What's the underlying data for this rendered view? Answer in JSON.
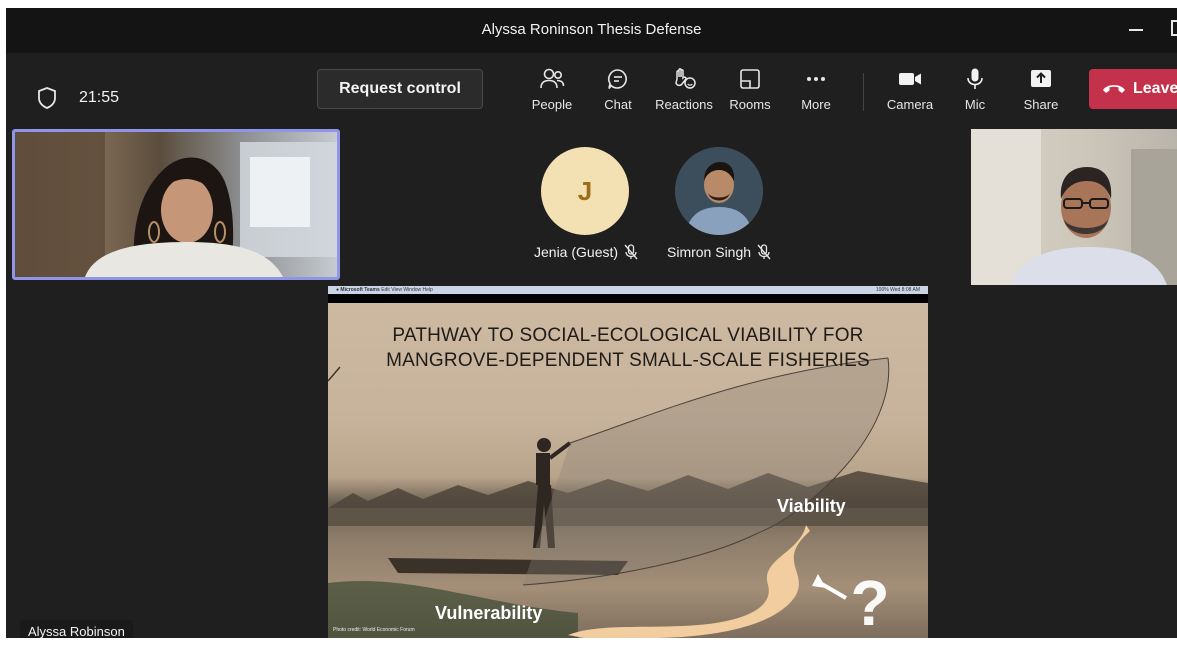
{
  "window": {
    "title": "Alyssa Roninson Thesis Defense"
  },
  "toolbar": {
    "timer": "21:55",
    "request_control": "Request control",
    "items": [
      {
        "label": "People",
        "icon": "people-icon"
      },
      {
        "label": "Chat",
        "icon": "chat-icon"
      },
      {
        "label": "Reactions",
        "icon": "reactions-icon"
      },
      {
        "label": "Rooms",
        "icon": "rooms-icon"
      },
      {
        "label": "More",
        "icon": "more-icon"
      },
      {
        "label": "Camera",
        "icon": "camera-icon"
      },
      {
        "label": "Mic",
        "icon": "mic-icon"
      },
      {
        "label": "Share",
        "icon": "share-icon"
      }
    ],
    "leave": "Leave",
    "leave_color": "#c4314b"
  },
  "participants": [
    {
      "name": "Alyssa Robinson",
      "active_speaker": true
    },
    {
      "name": "Jenia (Guest)",
      "initial": "J",
      "muted": true
    },
    {
      "name": "Simron Singh",
      "muted": true
    }
  ],
  "accent": "#8f95e8",
  "shared_screen": {
    "menu_bar": {
      "app": "Microsoft Teams",
      "menus": [
        "Edit",
        "View",
        "Window",
        "Help"
      ],
      "status": "100% Wed 8:08 AM"
    },
    "slide": {
      "title_line1": "PATHWAY TO SOCIAL-ECOLOGICAL VIABILITY FOR",
      "title_line2": "MANGROVE-DEPENDENT SMALL-SCALE FISHERIES",
      "label_top": "Viability",
      "label_bottom": "Vulnerability",
      "credit": "Photo credit: World Economic Forum"
    }
  }
}
